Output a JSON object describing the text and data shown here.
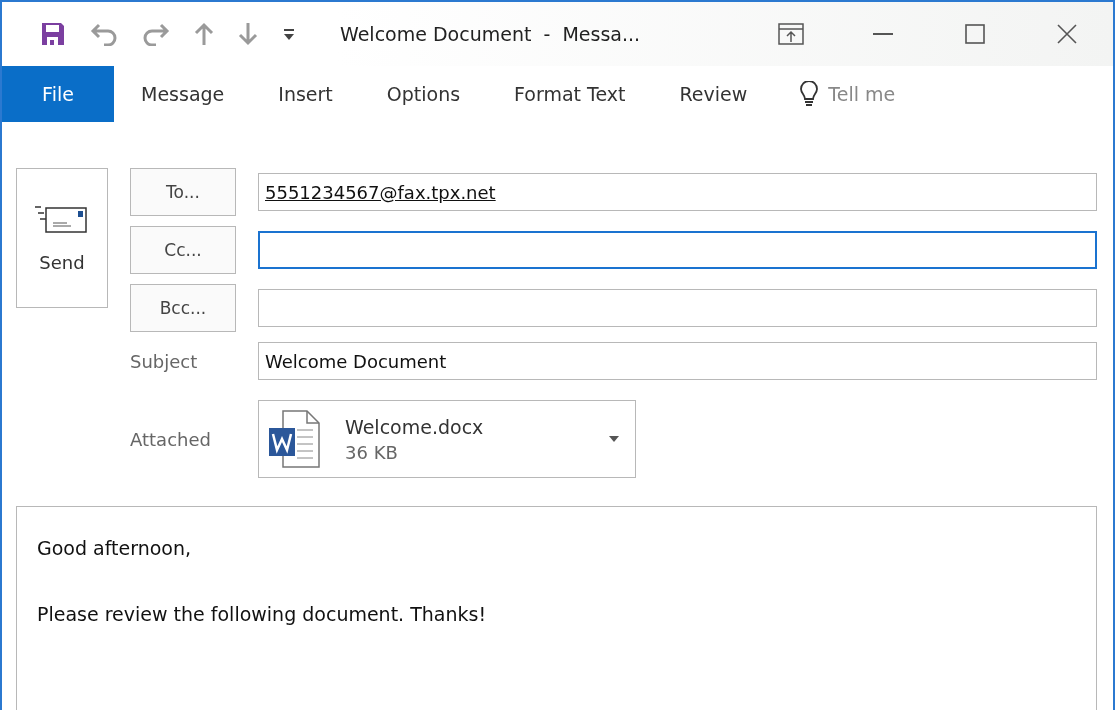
{
  "window": {
    "title": "Welcome Document  -  Messa..."
  },
  "tabs": [
    {
      "label": "File",
      "selected": true
    },
    {
      "label": "Message",
      "selected": false
    },
    {
      "label": "Insert",
      "selected": false
    },
    {
      "label": "Options",
      "selected": false
    },
    {
      "label": "Format Text",
      "selected": false
    },
    {
      "label": "Review",
      "selected": false
    }
  ],
  "tell_me": {
    "placeholder": "Tell me"
  },
  "send_button": {
    "label": "Send"
  },
  "recipients": [
    {
      "label": "To...",
      "value": "5551234567@fax.tpx.net",
      "focused": false
    },
    {
      "label": "Cc...",
      "focused": true
    },
    {
      "label": "Bcc...",
      "focused": false
    }
  ],
  "subject": {
    "label": "Subject",
    "value": "Welcome Document"
  },
  "attachment": {
    "label": "Attached",
    "name": "Welcome.docx",
    "size": "36 KB"
  },
  "body": [
    "Good afternoon,",
    "Please review the following document. Thanks!"
  ]
}
